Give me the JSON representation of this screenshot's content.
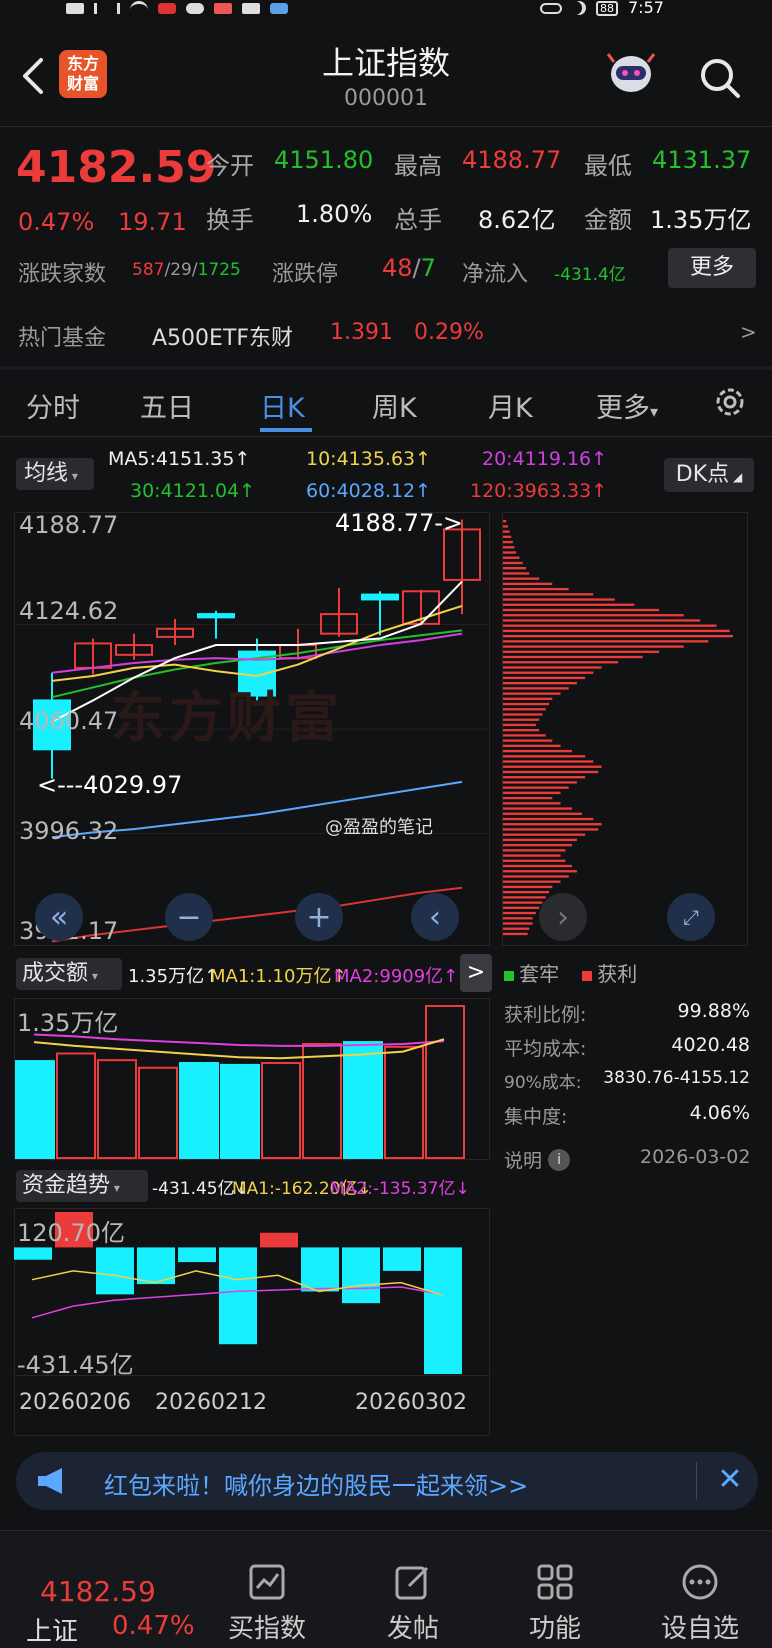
{
  "status": {
    "time": "7:57",
    "battery": "88"
  },
  "header": {
    "title": "上证指数",
    "code": "000001",
    "logo_line1": "东方",
    "logo_line2": "财富"
  },
  "quote": {
    "price": "4182.59",
    "change_pct": "0.47%",
    "change": "19.71",
    "open_label": "今开",
    "open": "4151.80",
    "high_label": "最高",
    "high": "4188.77",
    "low_label": "最低",
    "low": "4131.37",
    "turnover_label": "换手",
    "turnover": "1.80%",
    "volume_label": "总手",
    "volume": "8.62亿",
    "amount_label": "金额",
    "amount": "1.35万亿",
    "breadth_label": "涨跌家数",
    "breadth_up": "587",
    "breadth_flat": "29",
    "breadth_down": "1725",
    "limit_label": "涨跌停",
    "limit_up": "48",
    "limit_down": "7",
    "netflow_label": "净流入",
    "netflow": "-431.4亿",
    "more_button": "更多"
  },
  "hot_fund": {
    "label": "热门基金",
    "name": "A500ETF东财",
    "price": "1.391",
    "pct": "0.29%",
    "arrow": ">"
  },
  "tabs": [
    "分时",
    "五日",
    "日K",
    "周K",
    "月K",
    "更多"
  ],
  "active_tab": "日K",
  "ma_bar": {
    "selector": "均线",
    "ma5": "MA5:4151.35↑",
    "ma10": "10:4135.63↑",
    "ma20": "20:4119.16↑",
    "ma30": "30:4121.04↑",
    "ma60": "60:4028.12↑",
    "ma120": "120:3963.33↑",
    "dk_button": "DK点"
  },
  "kline": {
    "y_labels": [
      "4188.77",
      "4124.62",
      "4060.47",
      "3996.32",
      "3932.17"
    ],
    "high_marker": "4188.77->",
    "low_marker": "<---4029.97",
    "watermark": "东方财富",
    "credit": "@盈盈的笔记"
  },
  "chart_data": {
    "type": "candlestick",
    "ylim": [
      3932.17,
      4188.77
    ],
    "candles": [
      {
        "o": 4078,
        "c": 4048,
        "h": 4095,
        "l": 4030
      },
      {
        "o": 4098,
        "c": 4113,
        "h": 4116,
        "l": 4094
      },
      {
        "o": 4106,
        "c": 4112,
        "h": 4119,
        "l": 4103
      },
      {
        "o": 4117,
        "c": 4122,
        "h": 4128,
        "l": 4112
      },
      {
        "o": 4131,
        "c": 4129,
        "h": 4133,
        "l": 4116
      },
      {
        "o": 4108,
        "c": 4081,
        "h": 4116,
        "l": 4078
      },
      {
        "o": 4104,
        "c": 4112,
        "h": 4122,
        "l": 4103
      },
      {
        "o": 4119,
        "c": 4131,
        "h": 4147,
        "l": 4117
      },
      {
        "o": 4143,
        "c": 4140,
        "h": 4145,
        "l": 4118
      },
      {
        "o": 4125,
        "c": 4145,
        "h": 4146,
        "l": 4124
      },
      {
        "o": 4152,
        "c": 4183,
        "h": 4189,
        "l": 4131
      }
    ],
    "ma5": [
      4065,
      4078,
      4092,
      4104,
      4112,
      4112,
      4112,
      4114,
      4116,
      4125,
      4151
    ],
    "ma10": [
      4090,
      4093,
      4098,
      4100,
      4096,
      4093,
      4100,
      4110,
      4120,
      4128,
      4136
    ],
    "ma20": [
      4095,
      4098,
      4101,
      4103,
      4104,
      4103,
      4104,
      4108,
      4112,
      4115,
      4119
    ],
    "ma30": [
      4080,
      4086,
      4092,
      4097,
      4101,
      4104,
      4107,
      4111,
      4115,
      4118,
      4121
    ],
    "ma60": [
      3994,
      3997,
      3999,
      4002,
      4005,
      4008,
      4012,
      4016,
      4020,
      4024,
      4028
    ],
    "ma120": [
      3930,
      3934,
      3937,
      3940,
      3943,
      3946,
      3949,
      3952,
      3956,
      3960,
      3963
    ],
    "volume": {
      "label": "1.35万亿",
      "max": 1.6,
      "values": [
        1.02,
        1.1,
        1.03,
        0.95,
        1.0,
        0.98,
        1.0,
        1.2,
        1.22,
        1.17,
        1.6
      ],
      "up": [
        false,
        true,
        true,
        true,
        false,
        false,
        true,
        true,
        false,
        true,
        true
      ],
      "ma1": [
        1.22,
        1.18,
        1.15,
        1.12,
        1.09,
        1.06,
        1.05,
        1.07,
        1.09,
        1.12,
        1.25
      ],
      "ma2": [
        1.3,
        1.28,
        1.25,
        1.23,
        1.21,
        1.19,
        1.18,
        1.18,
        1.19,
        1.2,
        1.23
      ]
    },
    "fund_flow": {
      "max": 120.7,
      "min": -431.45,
      "values": [
        -42,
        120.7,
        -160,
        -125,
        -50,
        -330,
        50,
        -150,
        -190,
        -80,
        -431.45
      ],
      "ma1": [
        -110,
        -80,
        -95,
        -120,
        -80,
        -110,
        -95,
        -150,
        -130,
        -120,
        -162
      ],
      "ma2": [
        -240,
        -200,
        -180,
        -170,
        -160,
        -150,
        -145,
        -140,
        -140,
        -135,
        -160
      ]
    },
    "dates": [
      "20260206",
      "20260212",
      "20260302"
    ],
    "cost_distribution": [
      2,
      3,
      4,
      5,
      6,
      7,
      8,
      10,
      12,
      14,
      16,
      22,
      30,
      40,
      55,
      68,
      80,
      95,
      110,
      120,
      130,
      138,
      140,
      125,
      110,
      95,
      85,
      70,
      60,
      55,
      50,
      45,
      40,
      35,
      30,
      28,
      26,
      24,
      22,
      20,
      22,
      26,
      30,
      35,
      42,
      50,
      55,
      60,
      58,
      50,
      45,
      40,
      35,
      30,
      35,
      42,
      48,
      55,
      60,
      58,
      50,
      45,
      42,
      38,
      35,
      38,
      42,
      45,
      40,
      35,
      30,
      28,
      26,
      24,
      22,
      20,
      18,
      18,
      16,
      15
    ]
  },
  "vol_bar": {
    "selector": "成交额",
    "value": "1.35万亿↑",
    "ma1": "MA1:1.10万亿↑",
    "ma2": "MA2:9909亿↑",
    "next": ">"
  },
  "flow_bar": {
    "selector": "资金趋势",
    "value": "-431.45亿↓",
    "ma1": "MA1:-162.20亿↓",
    "ma2": "MA2:-135.37亿↓",
    "top_label": "120.70亿",
    "bottom_label": "-431.45亿"
  },
  "chip_panel": {
    "legend_trapped": "套牢",
    "legend_profit": "获利",
    "rows": [
      {
        "label": "获利比例:",
        "value": "99.88%"
      },
      {
        "label": "平均成本:",
        "value": "4020.48"
      },
      {
        "label": "90%成本:",
        "value": "3830.76-4155.12"
      },
      {
        "label": "集中度:",
        "value": "4.06%"
      }
    ],
    "note": "说明",
    "date": "2026-03-02"
  },
  "banner": {
    "text": "红包来啦！喊你身边的股民一起来领>>"
  },
  "bottom": {
    "price": "4182.59",
    "name": "上证",
    "pct": "0.47%",
    "items": [
      {
        "label": "买指数",
        "icon": "chart-icon"
      },
      {
        "label": "发帖",
        "icon": "edit-icon"
      },
      {
        "label": "功能",
        "icon": "grid-icon"
      },
      {
        "label": "设自选",
        "icon": "more-icon"
      }
    ]
  },
  "colors": {
    "up": "#ec3b3b",
    "down": "#22c02a",
    "cyan": "#19f0ff",
    "accent": "#4a90e2"
  }
}
